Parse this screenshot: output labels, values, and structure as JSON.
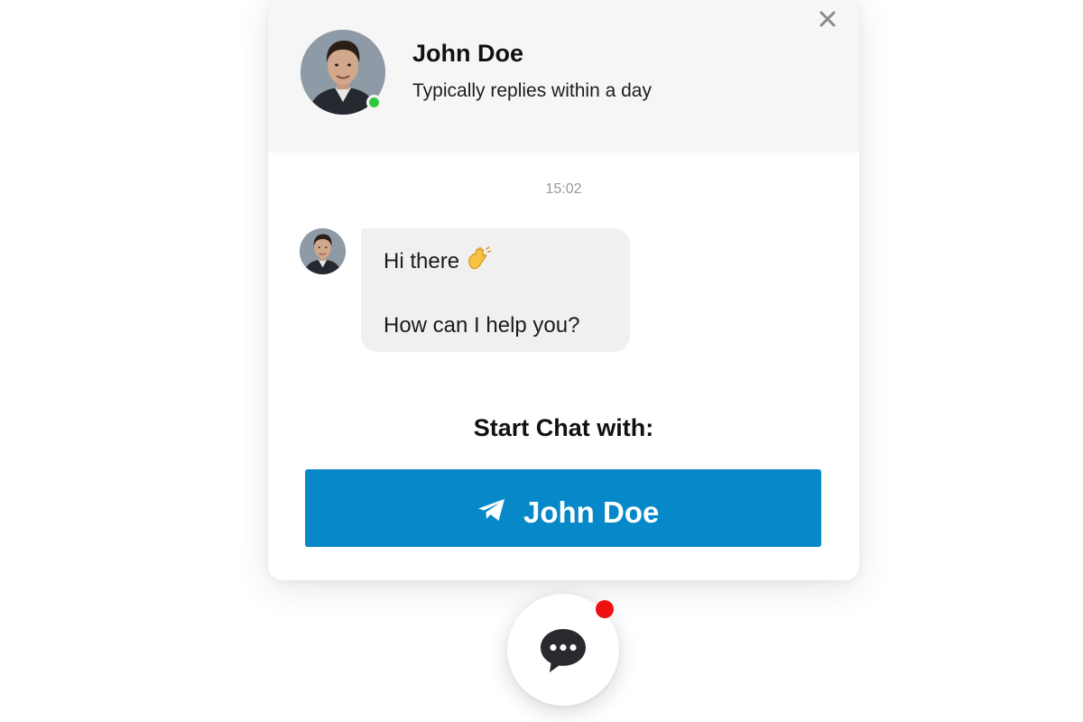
{
  "header": {
    "agent_name": "John Doe",
    "agent_status": "Typically replies within a day",
    "close_icon": "close-icon",
    "online_color": "#2fc83a"
  },
  "conversation": {
    "timestamp": "15:02",
    "message_lines": [
      "Hi there",
      "How can I help you?"
    ],
    "emoji_icon": "waving-hand-icon"
  },
  "start_chat": {
    "label": "Start Chat with:",
    "button_label": "John Doe",
    "button_icon": "telegram-plane-icon",
    "button_color": "#0788c9"
  },
  "launcher": {
    "icon": "chat-bubble-icon",
    "notification_color": "#ee1111"
  }
}
